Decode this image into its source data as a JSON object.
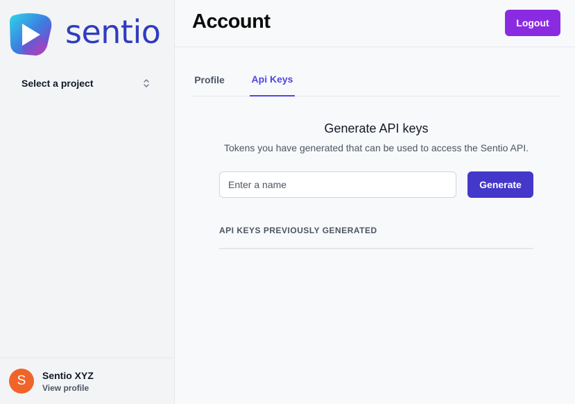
{
  "brand": {
    "name": "sentio",
    "color": "#2f3dbf"
  },
  "sidebar": {
    "project_select": {
      "label": "Select a project",
      "icon": "chevron-up-down-icon"
    }
  },
  "user": {
    "initial": "S",
    "name": "Sentio XYZ",
    "view_profile": "View profile",
    "avatar_color": "#f0642a"
  },
  "header": {
    "title": "Account",
    "logout_label": "Logout",
    "logout_color": "#8a2be2"
  },
  "tabs": [
    {
      "label": "Profile",
      "active": false
    },
    {
      "label": "Api Keys",
      "active": true
    }
  ],
  "api_keys": {
    "title": "Generate API keys",
    "description": "Tokens you have generated that can be used to access the Sentio API.",
    "name_input": {
      "placeholder": "Enter a name",
      "value": ""
    },
    "generate_label": "Generate",
    "generate_color": "#4338ca",
    "previous_heading": "API KEYS PREVIOUSLY GENERATED"
  }
}
